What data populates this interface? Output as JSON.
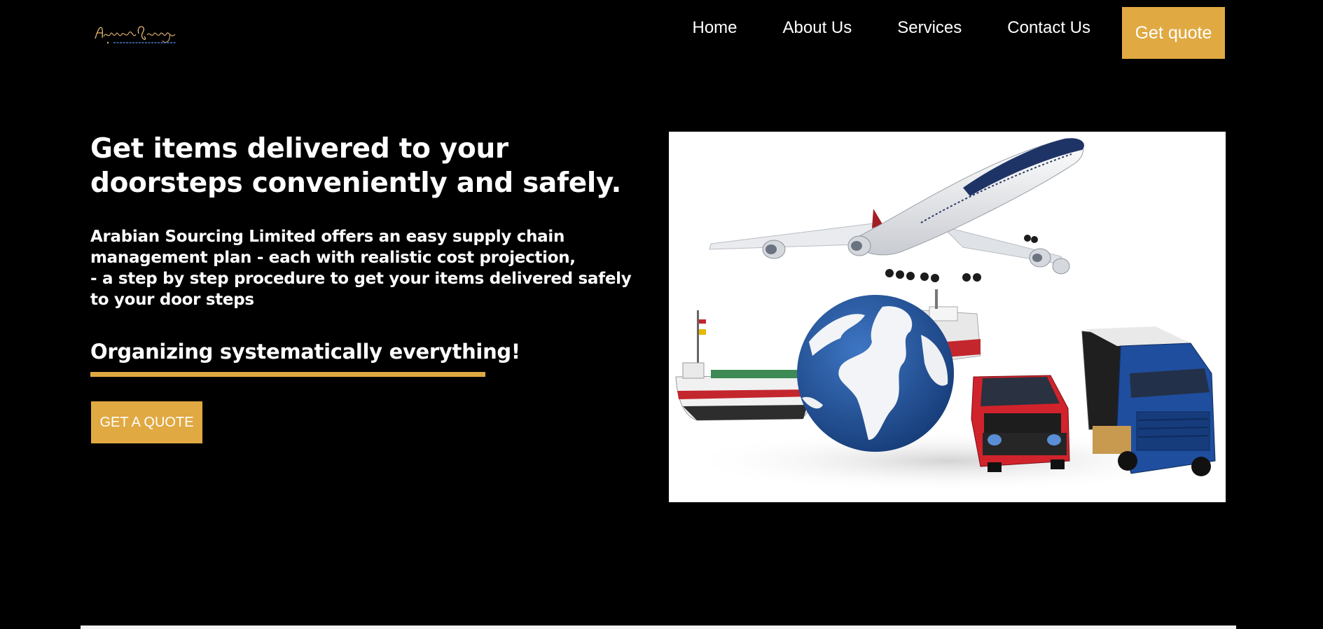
{
  "brand": {
    "logo_text": "ArabianSourcing",
    "logo_subtext": "SUPPLY CHAIN MANAGEMENT"
  },
  "nav": {
    "items": [
      {
        "label": "Home"
      },
      {
        "label": "About Us"
      },
      {
        "label": "Services"
      },
      {
        "label": "Contact Us"
      }
    ],
    "cta_label": "Get quote"
  },
  "hero": {
    "title": "Get items delivered to your doorsteps conveniently and safely.",
    "description_line1": "Arabian Sourcing Limited offers an easy supply chain management plan - each with realistic cost projection,",
    "description_line2": "- a step by step procedure to get your items delivered safely to your door steps",
    "tagline": "Organizing systematically everything!",
    "cta_label": "GET A QUOTE"
  },
  "colors": {
    "background": "#000000",
    "accent": "#e0a942",
    "text": "#ffffff"
  }
}
